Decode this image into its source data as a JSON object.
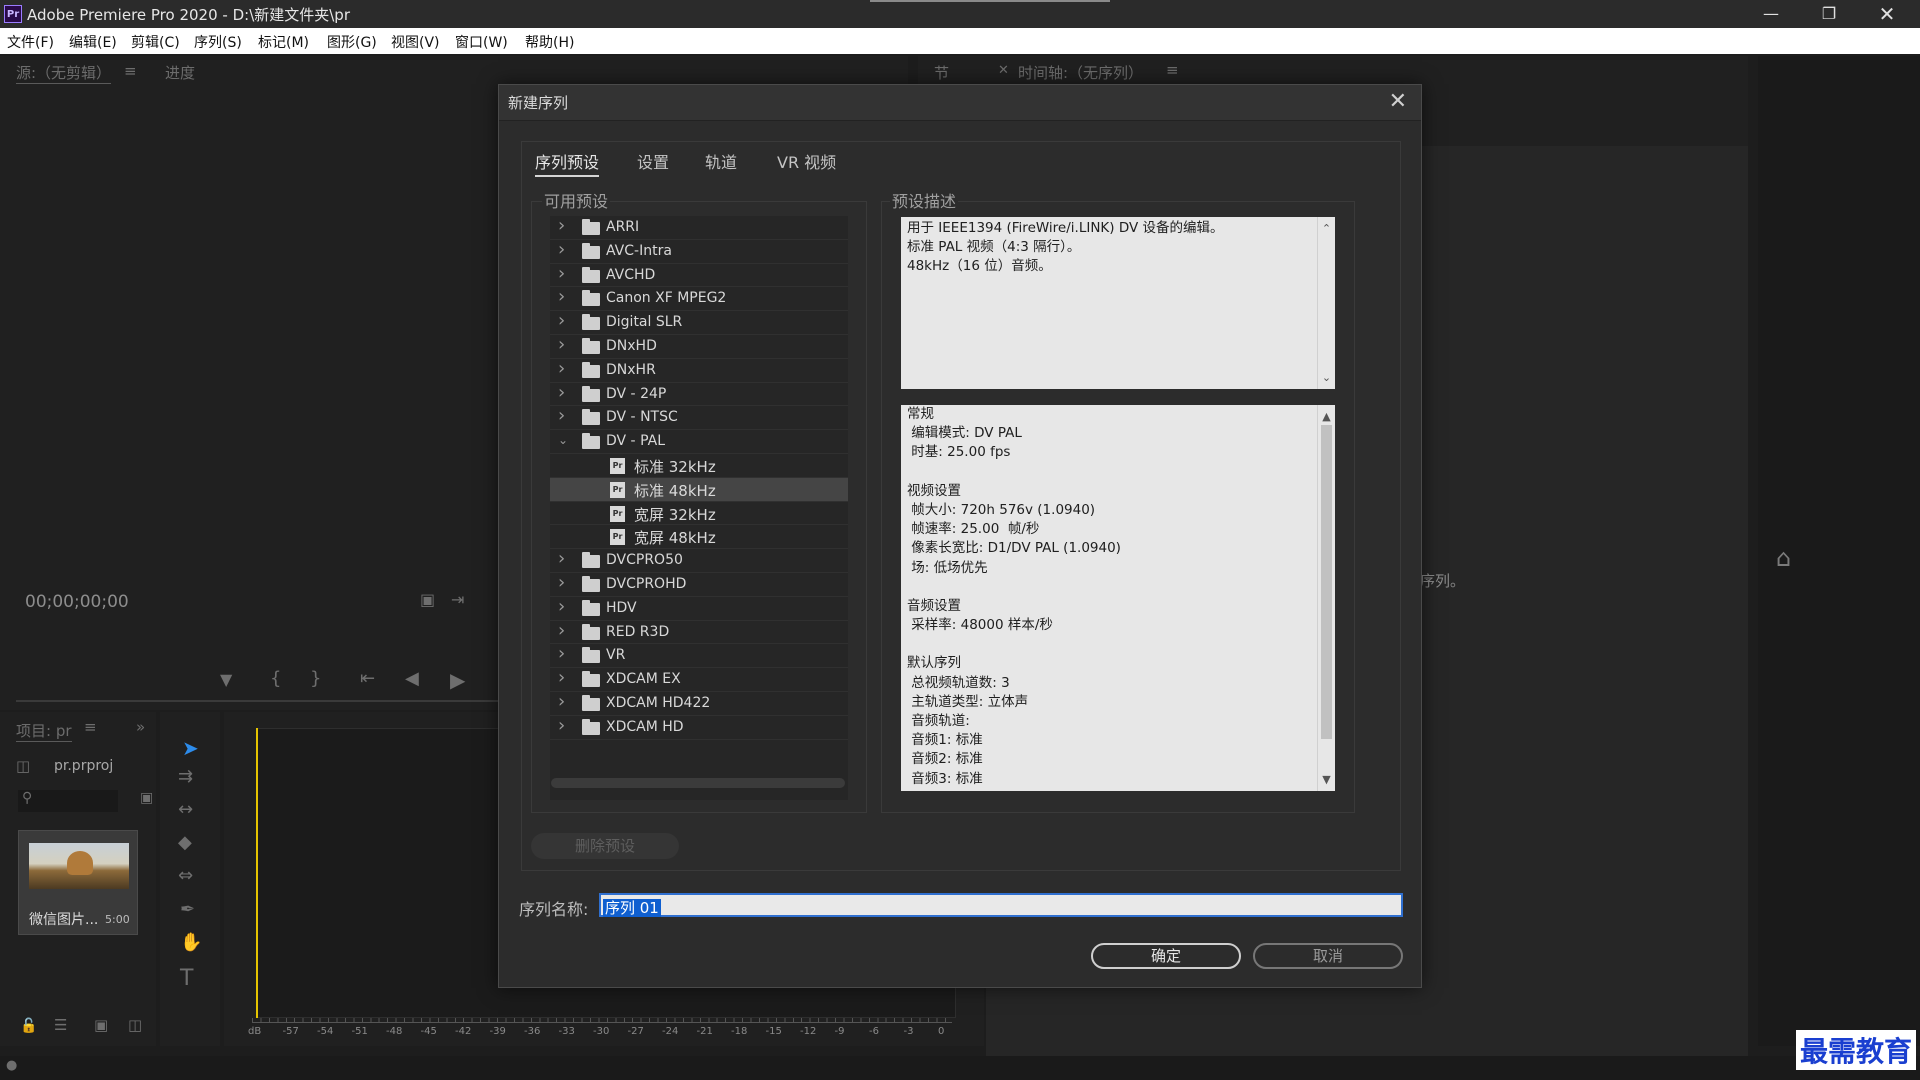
{
  "window": {
    "title": "Adobe Premiere Pro 2020 - D:\\新建文件夹\\pr",
    "app_icon": "Pr",
    "controls": [
      "minimize-icon",
      "maximize-icon",
      "close-icon"
    ]
  },
  "menu": [
    "文件(F)",
    "编辑(E)",
    "剪辑(C)",
    "序列(S)",
    "标记(M)",
    "图形(G)",
    "视图(V)",
    "窗口(W)",
    "帮助(H)"
  ],
  "source_panel": {
    "tab_source": "源:（无剪辑）",
    "tab_progress": "进度",
    "timecode": "00;00;00;00"
  },
  "timeline_panel": {
    "tab_label": "时间轴:（无序列）",
    "tab_node": "节",
    "hint_fragment": "序列。"
  },
  "project_panel": {
    "tab_label": "项目: pr",
    "file_name": "pr.prproj",
    "clip_name": "微信图片...",
    "clip_duration": "5:00"
  },
  "audio_meter": {
    "ticks": [
      "dB",
      "-57",
      "-54",
      "-51",
      "-48",
      "-45",
      "-42",
      "-39",
      "-36",
      "-33",
      "-30",
      "-27",
      "-24",
      "-21",
      "-18",
      "-15",
      "-12",
      "-9",
      "-6",
      "-3",
      "0"
    ]
  },
  "dialog": {
    "title": "新建序列",
    "tabs": [
      "序列预设",
      "设置",
      "轨道",
      "VR 视频"
    ],
    "available_presets_label": "可用预设",
    "preset_desc_label": "预设描述",
    "tree": [
      {
        "label": "ARRI",
        "type": "folder",
        "expanded": false
      },
      {
        "label": "AVC-Intra",
        "type": "folder",
        "expanded": false
      },
      {
        "label": "AVCHD",
        "type": "folder",
        "expanded": false
      },
      {
        "label": "Canon XF MPEG2",
        "type": "folder",
        "expanded": false
      },
      {
        "label": "Digital SLR",
        "type": "folder",
        "expanded": false
      },
      {
        "label": "DNxHD",
        "type": "folder",
        "expanded": false
      },
      {
        "label": "DNxHR",
        "type": "folder",
        "expanded": false
      },
      {
        "label": "DV - 24P",
        "type": "folder",
        "expanded": false
      },
      {
        "label": "DV - NTSC",
        "type": "folder",
        "expanded": false
      },
      {
        "label": "DV - PAL",
        "type": "folder",
        "expanded": true
      },
      {
        "label": "标准 32kHz",
        "type": "preset",
        "selected": false
      },
      {
        "label": "标准 48kHz",
        "type": "preset",
        "selected": true
      },
      {
        "label": "宽屏 32kHz",
        "type": "preset",
        "selected": false
      },
      {
        "label": "宽屏 48kHz",
        "type": "preset",
        "selected": false
      },
      {
        "label": "DVCPRO50",
        "type": "folder",
        "expanded": false
      },
      {
        "label": "DVCPROHD",
        "type": "folder",
        "expanded": false
      },
      {
        "label": "HDV",
        "type": "folder",
        "expanded": false
      },
      {
        "label": "RED R3D",
        "type": "folder",
        "expanded": false
      },
      {
        "label": "VR",
        "type": "folder",
        "expanded": false
      },
      {
        "label": "XDCAM EX",
        "type": "folder",
        "expanded": false
      },
      {
        "label": "XDCAM HD422",
        "type": "folder",
        "expanded": false
      },
      {
        "label": "XDCAM HD",
        "type": "folder",
        "expanded": false
      }
    ],
    "description_lines": [
      "用于 IEEE1394 (FireWire/i.LINK) DV 设备的编辑。",
      "标准 PAL 视频（4:3 隔行）。",
      "48kHz（16 位）音频。"
    ],
    "details_lines": [
      "常规",
      " 编辑模式: DV PAL",
      " 时基: 25.00 fps",
      "",
      "视频设置",
      " 帧大小: 720h 576v (1.0940)",
      " 帧速率: 25.00  帧/秒",
      " 像素长宽比: D1/DV PAL (1.0940)",
      " 场: 低场优先",
      "",
      "音频设置",
      " 采样率: 48000 样本/秒",
      "",
      "默认序列",
      " 总视频轨道数: 3",
      " 主轨道类型: 立体声",
      " 音频轨道:",
      " 音频1: 标准",
      " 音频2: 标准",
      " 音频3: 标准"
    ],
    "delete_preset_label": "删除预设",
    "sequence_name_label": "序列名称:",
    "sequence_name_value": "序列 01",
    "ok_label": "确定",
    "cancel_label": "取消"
  },
  "watermark": "最需教育",
  "colors": {
    "selection_blue": "#0f5fd0",
    "playhead_yellow": "#e5c400",
    "watermark_blue": "#1a3fd0"
  }
}
